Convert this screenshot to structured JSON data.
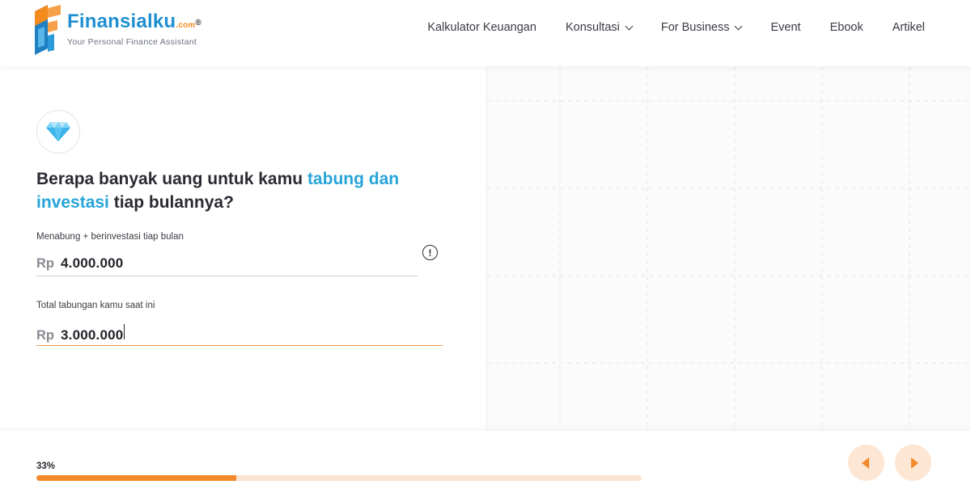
{
  "header": {
    "logo": {
      "name": "Finansialku",
      "domain": ".com",
      "reg": "®",
      "tagline": "Your Personal Finance Assistant"
    },
    "nav": [
      {
        "label": "Kalkulator Keuangan",
        "dropdown": false
      },
      {
        "label": "Konsultasi",
        "dropdown": true
      },
      {
        "label": "For Business",
        "dropdown": true
      },
      {
        "label": "Event",
        "dropdown": false
      },
      {
        "label": "Ebook",
        "dropdown": false
      },
      {
        "label": "Artikel",
        "dropdown": false
      }
    ]
  },
  "form": {
    "icon": "diamond-icon",
    "question": {
      "part1": "Berapa banyak uang untuk kamu ",
      "highlight1": "tabung dan",
      "highlight2": "investasi",
      "part2": " tiap bulannya?"
    },
    "monthly": {
      "label": "Menabung + berinvestasi tiap bulan",
      "currency": "Rp",
      "value": "4.000.000"
    },
    "savings": {
      "label": "Total tabungan kamu saat ini",
      "currency": "Rp",
      "value": "3.000.000"
    },
    "info_icon": "!"
  },
  "progress": {
    "label": "33%",
    "value": 0.33
  },
  "colors": {
    "accent": "#f28a2a",
    "highlight": "#27a4d8",
    "brand_blue": "#1f8fd0"
  }
}
